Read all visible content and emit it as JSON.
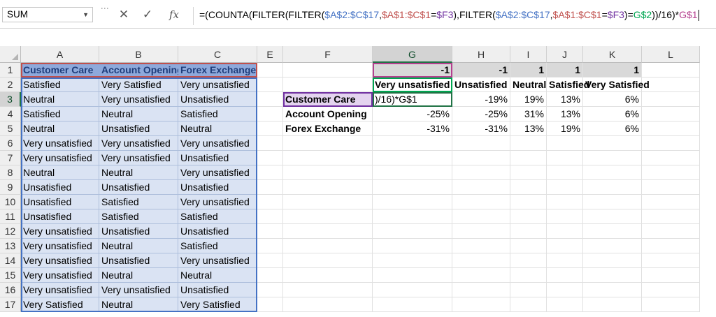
{
  "name_box": "SUM",
  "formula_bar": {
    "dots": "⋮",
    "cancel_icon": "✕",
    "enter_icon": "✓",
    "fx_label": "fx",
    "parts": [
      {
        "t": "=(COUNTA(FILTER(FILTER(",
        "c": "#000000"
      },
      {
        "t": "$A$2:$C$17",
        "c": "#4472c4"
      },
      {
        "t": ",",
        "c": "#000000"
      },
      {
        "t": "$A$1:$C$1",
        "c": "#c0504d"
      },
      {
        "t": "=",
        "c": "#000000"
      },
      {
        "t": "$F3",
        "c": "#7030a0"
      },
      {
        "t": "),FILTER(",
        "c": "#000000"
      },
      {
        "t": "$A$2:$C$17",
        "c": "#4472c4"
      },
      {
        "t": ",",
        "c": "#000000"
      },
      {
        "t": "$A$1:$C$1",
        "c": "#c0504d"
      },
      {
        "t": "=",
        "c": "#000000"
      },
      {
        "t": "$F3",
        "c": "#7030a0"
      },
      {
        "t": ")=",
        "c": "#000000"
      },
      {
        "t": "G$2",
        "c": "#00a651"
      },
      {
        "t": "))/16)*",
        "c": "#000000"
      },
      {
        "t": "G$1",
        "c": "#b43f8e"
      }
    ]
  },
  "columns": [
    "A",
    "B",
    "C",
    "E",
    "F",
    "G",
    "H",
    "I",
    "J",
    "K",
    "L"
  ],
  "rows": [
    "1",
    "2",
    "3",
    "4",
    "5",
    "6",
    "7",
    "8",
    "9",
    "10",
    "11",
    "12",
    "13",
    "14",
    "15",
    "16",
    "17"
  ],
  "data_table": {
    "headers": [
      "Customer Care",
      "Account Opening",
      "Forex Exchange"
    ],
    "rows": [
      [
        "Satisfied",
        "Very Satisfied",
        "Very unsatisfied"
      ],
      [
        "Neutral",
        "Very unsatisfied",
        "Unsatisfied"
      ],
      [
        "Satisfied",
        "Neutral",
        "Satisfied"
      ],
      [
        "Neutral",
        "Unsatisfied",
        "Neutral"
      ],
      [
        "Very unsatisfied",
        "Very unsatisfied",
        "Very unsatisfied"
      ],
      [
        "Very unsatisfied",
        "Very unsatisfied",
        "Unsatisfied"
      ],
      [
        "Neutral",
        "Neutral",
        "Very unsatisfied"
      ],
      [
        "Unsatisfied",
        "Unsatisfied",
        "Unsatisfied"
      ],
      [
        "Unsatisfied",
        "Satisfied",
        "Very unsatisfied"
      ],
      [
        "Unsatisfied",
        "Satisfied",
        "Satisfied"
      ],
      [
        "Very unsatisfied",
        "Unsatisfied",
        "Unsatisfied"
      ],
      [
        "Very unsatisfied",
        "Neutral",
        "Satisfied"
      ],
      [
        "Very unsatisfied",
        "Unsatisfied",
        "Very unsatisfied"
      ],
      [
        "Very unsatisfied",
        "Neutral",
        "Neutral"
      ],
      [
        "Very unsatisfied",
        "Very unsatisfied",
        "Unsatisfied"
      ],
      [
        "Very Satisfied",
        "Neutral",
        "Very Satisfied"
      ]
    ]
  },
  "summary_table": {
    "weights": [
      "-1",
      "-1",
      "1",
      "1",
      "1"
    ],
    "categories": [
      "Very unsatisfied",
      "Unsatisfied",
      "Neutral",
      "Satisfied",
      "Very Satisfied"
    ],
    "row_labels": [
      "Customer Care",
      "Account Opening",
      "Forex Exchange"
    ],
    "values": [
      [
        ")/16)*G$1",
        "-19%",
        "19%",
        "13%",
        "6%"
      ],
      [
        "-25%",
        "-25%",
        "31%",
        "13%",
        "6%"
      ],
      [
        "-31%",
        "-31%",
        "13%",
        "19%",
        "6%"
      ]
    ]
  },
  "colors": {
    "header_blue": "#8ea9db",
    "range_blue": "#dae3f3",
    "criteria_purple": "#e4d4ef",
    "active_green": "#217346"
  }
}
